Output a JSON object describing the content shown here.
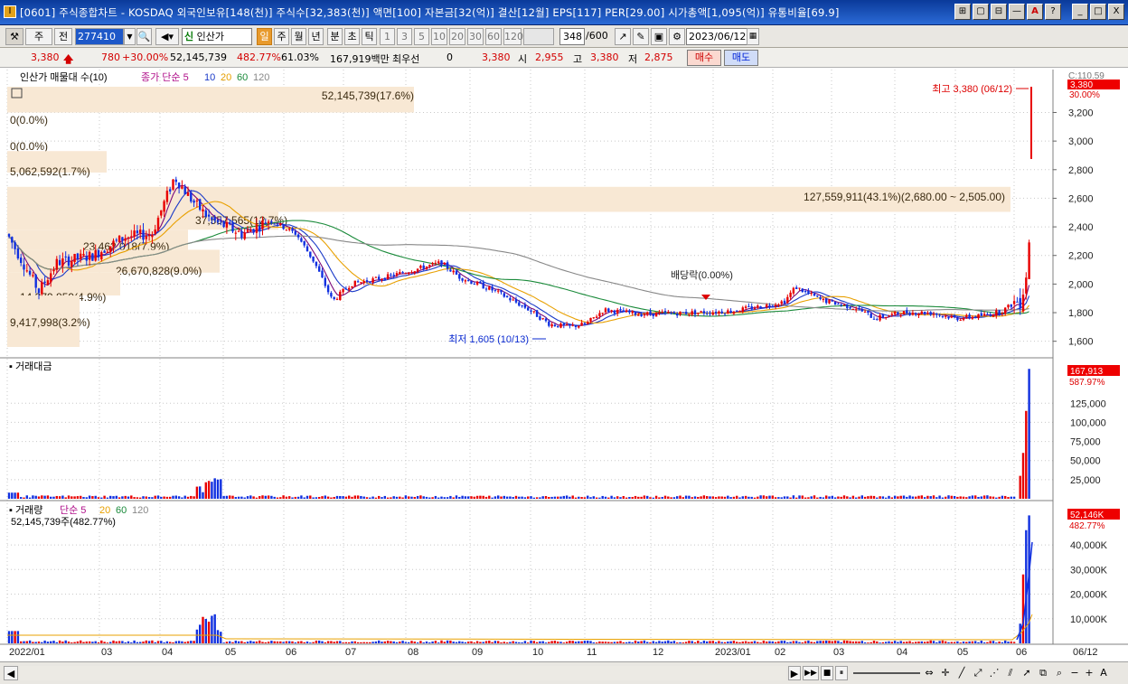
{
  "title": {
    "icon": "I",
    "text": "[0601] 주식종합차트 - KOSDAQ 외국인보유[148(천)] 주식수[32,383(천)] 액면[100] 자본금[32(억)] 결산[12월] EPS[117] PER[29.00] 시가총액[1,095(억)] 유통비율[69.9]",
    "buttons": [
      "⊞",
      "▢",
      "⊟",
      "—",
      "A",
      "?"
    ],
    "window": [
      "_",
      "□",
      "X"
    ]
  },
  "toolbar": {
    "mode": "주",
    "prev": "전",
    "code": "277410",
    "name_prefix": "신",
    "name": "인산가",
    "periods": [
      "일",
      "주",
      "월",
      "년",
      "분",
      "초",
      "틱"
    ],
    "active_period": "일",
    "intervals": [
      "1",
      "3",
      "5",
      "10",
      "20",
      "30",
      "60",
      "120"
    ],
    "count": "348",
    "count_total": "/600",
    "date": "2023/06/12"
  },
  "quote": {
    "price": "3,380",
    "change": "780",
    "change_pct": "+30.00%",
    "volume": "52,145,739",
    "vol_ratio": "482.77%",
    "turnover": "61.03%",
    "amount": "167,919백만",
    "bid_label": "최우선",
    "bid": "0",
    "ask": "3,380",
    "open_label": "시",
    "open": "2,955",
    "high_label": "고",
    "high": "3,380",
    "low_label": "저",
    "low": "2,875",
    "buy": "매수",
    "sell": "매도"
  },
  "colors": {
    "up": "#e80000",
    "down": "#1030e0",
    "ma5": "#7a0a7a",
    "ma10": "#1a3ac8",
    "ma20": "#e8a000",
    "ma60": "#1a8a3a",
    "ma120": "#888888",
    "volume_band": "#f8e8d4"
  },
  "panes": {
    "price": {
      "legend": [
        "인산가 매물대 수(10)",
        "종가 단순 5",
        "10",
        "20",
        "60",
        "120"
      ],
      "current_label": "3,380",
      "top_label": "C:110.59",
      "pct_label": "30.00%",
      "high_note": "최고 3,380 (06/12)",
      "low_note": "최저 1,605 (10/13)",
      "dividend": "배당락(0.00%)",
      "y_ticks": [
        "3,200",
        "3,000",
        "2,800",
        "2,600",
        "2,400",
        "2,200",
        "2,000",
        "1,800",
        "1,600"
      ],
      "volume_profile": [
        "52,145,739(17.6%)",
        "0(0.0%)",
        "0(0.0%)",
        "5,062,592(1.7%)",
        "127,559,911(43.1%)(2,680.00 ~ 2,505.00)",
        "37,557,565(12.7%)",
        "23,462,018(7.9%)",
        "26,670,828(9.0%)",
        "14,379,859(4.9%)",
        "9,417,998(3.2%)"
      ]
    },
    "amount": {
      "legend": "거래대금",
      "current_label": "167,913",
      "pct_label": "587.97%",
      "y_ticks": [
        "125,000",
        "100,000",
        "75,000",
        "50,000",
        "25,000"
      ]
    },
    "volume": {
      "legend": [
        "거래량",
        "단순 5",
        "20",
        "60",
        "120"
      ],
      "sub": "52,145,739주(482.77%)",
      "current_label": "52,146K",
      "pct_label": "482.77%",
      "y_ticks": [
        "40,000K",
        "30,000K",
        "20,000K",
        "10,000K"
      ]
    }
  },
  "x_labels": [
    "2022/01",
    "03",
    "04",
    "05",
    "06",
    "07",
    "08",
    "09",
    "10",
    "11",
    "12",
    "2023/01",
    "02",
    "03",
    "04",
    "05",
    "06",
    "06/12"
  ],
  "scroll": {
    "buttons": [
      "◀",
      "▶",
      "▶▶",
      "■",
      "⏸",
      "⏭"
    ],
    "tools": [
      "−",
      "+",
      "A"
    ]
  },
  "chart_data": {
    "type": "candlestick",
    "title": "인산가 일봉",
    "x_range": [
      "2022/01",
      "2023/06/12"
    ],
    "ylim": [
      1560,
      3380
    ],
    "key_points": [
      {
        "date": "2022/04 (late)",
        "high": 2840
      },
      {
        "date": "2022/10/13",
        "low": 1605
      },
      {
        "date": "2023/06/12",
        "close": 3380,
        "high": 3380
      }
    ],
    "volume_ylim": [
      0,
      52146
    ],
    "amount_ylim": [
      0,
      167913
    ]
  }
}
